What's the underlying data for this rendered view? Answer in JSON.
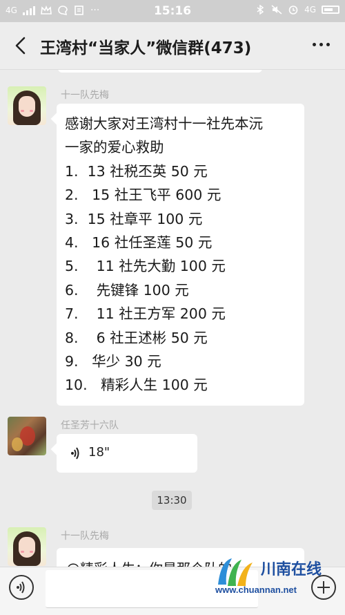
{
  "status_bar": {
    "network_left": "4G",
    "time": "15:16",
    "network_right": "4G"
  },
  "header": {
    "title": "王湾村“当家人”微信群(473)"
  },
  "messages": [
    {
      "sender": "十一队先梅",
      "lines": [
        "感谢大家对王湾村十一社先本沅",
        "一家的爱心救助",
        "1.  13 社税丕英 50 元",
        "2.   15 社王飞平 600 元",
        "3.  15 社章平 100 元",
        "4.   16 社任圣莲 50 元",
        "5.    11 社先大勤 100 元",
        "6.    先键锋 100 元",
        "7.    11 社王方军 200 元",
        "8.    6 社王述彬 50 元",
        "9.   华少 30 元",
        "10.   精彩人生 100 元"
      ]
    },
    {
      "sender": "任圣芳十六队",
      "voice_duration": "18\""
    },
    {
      "sender": "十一队先梅",
      "partial_text": "@精彩人生：你是那个队的"
    }
  ],
  "time_divider": "13:30",
  "watermark": {
    "name": "川南在线",
    "url": "www.chuannan.net"
  },
  "colors": {
    "background": "#ebebeb",
    "bubble": "#ffffff",
    "watermark_blue": "#1e4fa0"
  }
}
